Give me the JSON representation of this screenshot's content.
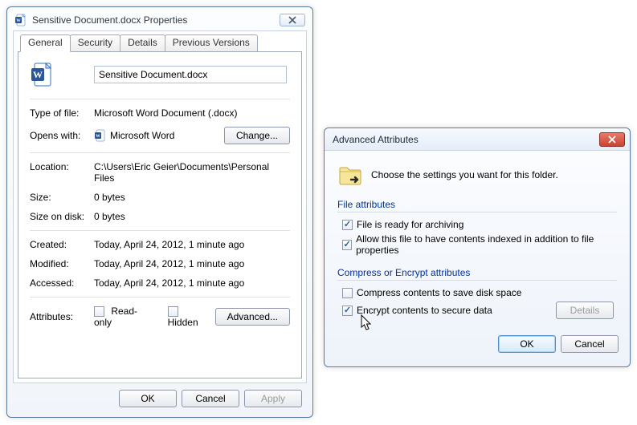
{
  "properties": {
    "title": "Sensitive Document.docx Properties",
    "tabs": {
      "general": "General",
      "security": "Security",
      "details": "Details",
      "previous": "Previous Versions"
    },
    "filename": "Sensitive Document.docx",
    "labels": {
      "type": "Type of file:",
      "opens": "Opens with:",
      "location": "Location:",
      "size": "Size:",
      "sizeondisk": "Size on disk:",
      "created": "Created:",
      "modified": "Modified:",
      "accessed": "Accessed:",
      "attributes": "Attributes:"
    },
    "type_value": "Microsoft Word Document (.docx)",
    "opens_value": "Microsoft Word",
    "change_label": "Change...",
    "location_value": "C:\\Users\\Eric Geier\\Documents\\Personal Files",
    "size_value": "0 bytes",
    "sizeondisk_value": "0 bytes",
    "created_value": "Today, April 24, 2012, 1 minute ago",
    "modified_value": "Today, April 24, 2012, 1 minute ago",
    "accessed_value": "Today, April 24, 2012, 1 minute ago",
    "readonly_label": "Read-only",
    "hidden_label": "Hidden",
    "advanced_label": "Advanced...",
    "ok": "OK",
    "cancel": "Cancel",
    "apply": "Apply"
  },
  "advanced": {
    "title": "Advanced Attributes",
    "intro": "Choose the settings you want for this folder.",
    "group1_title": "File attributes",
    "archiving": "File is ready for archiving",
    "indexing": "Allow this file to have contents indexed in addition to file properties",
    "group2_title": "Compress or Encrypt attributes",
    "compress": "Compress contents to save disk space",
    "encrypt": "Encrypt contents to secure data",
    "details": "Details",
    "ok": "OK",
    "cancel": "Cancel"
  }
}
